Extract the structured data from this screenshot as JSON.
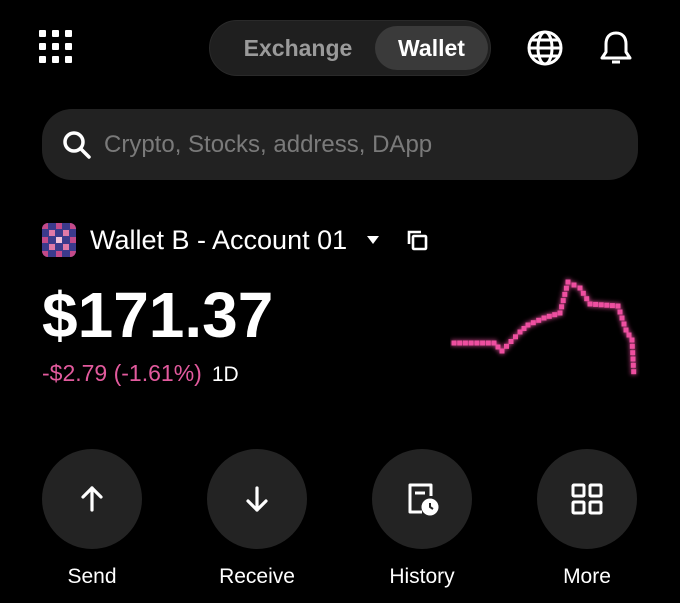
{
  "header": {
    "tabs": [
      {
        "label": "Exchange",
        "active": false
      },
      {
        "label": "Wallet",
        "active": true
      }
    ],
    "icons": [
      "grid-menu-icon",
      "globe-icon",
      "bell-icon"
    ]
  },
  "search": {
    "placeholder": "Crypto, Stocks, address, DApp"
  },
  "account": {
    "name": "Wallet B - Account 01"
  },
  "balance": {
    "amount": "$171.37",
    "change": "-$2.79 (-1.61%)",
    "period": "1D"
  },
  "colors": {
    "accent_negative": "#e25a9d",
    "background": "#000000",
    "surface": "#232323"
  },
  "actions": [
    {
      "label": "Send",
      "icon": "arrow-up-icon"
    },
    {
      "label": "Receive",
      "icon": "arrow-down-icon"
    },
    {
      "label": "History",
      "icon": "history-icon"
    },
    {
      "label": "More",
      "icon": "grid-icon"
    }
  ]
}
